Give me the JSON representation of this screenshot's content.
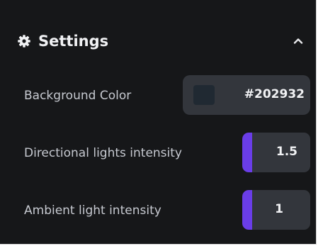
{
  "settings": {
    "title": "Settings",
    "icons": {
      "header": "gear-icon",
      "collapse": "chevron-up-icon"
    },
    "colors": {
      "panel_background": "#161719",
      "field_background": "#33363c",
      "accent": "#6a3de8"
    },
    "background_color": {
      "label": "Background Color",
      "value": "#202932"
    },
    "directional_lights": {
      "label": "Directional lights intensity",
      "value": "1.5"
    },
    "ambient_light": {
      "label": "Ambient light intensity",
      "value": "1"
    }
  }
}
